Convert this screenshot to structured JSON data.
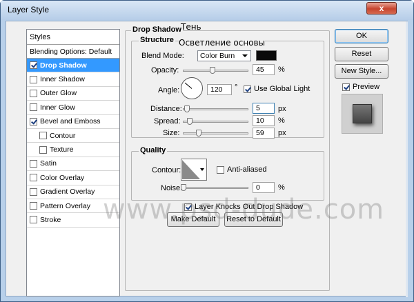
{
  "window": {
    "title": "Layer Style",
    "close_glyph": "x"
  },
  "sidebar": {
    "header": "Styles",
    "blending_options": "Blending Options: Default",
    "items": [
      {
        "label": "Drop Shadow",
        "checked": true,
        "active": true,
        "sub": false
      },
      {
        "label": "Inner Shadow",
        "checked": false,
        "active": false,
        "sub": false
      },
      {
        "label": "Outer Glow",
        "checked": false,
        "active": false,
        "sub": false
      },
      {
        "label": "Inner Glow",
        "checked": false,
        "active": false,
        "sub": false
      },
      {
        "label": "Bevel and Emboss",
        "checked": true,
        "active": false,
        "sub": false
      },
      {
        "label": "Contour",
        "checked": false,
        "active": false,
        "sub": true
      },
      {
        "label": "Texture",
        "checked": false,
        "active": false,
        "sub": true
      },
      {
        "label": "Satin",
        "checked": false,
        "active": false,
        "sub": false
      },
      {
        "label": "Color Overlay",
        "checked": false,
        "active": false,
        "sub": false
      },
      {
        "label": "Gradient Overlay",
        "checked": false,
        "active": false,
        "sub": false
      },
      {
        "label": "Pattern Overlay",
        "checked": false,
        "active": false,
        "sub": false
      },
      {
        "label": "Stroke",
        "checked": false,
        "active": false,
        "sub": false
      }
    ]
  },
  "drop_shadow": {
    "section_title": "Drop Shadow",
    "structure": {
      "title": "Structure",
      "blend_mode_label": "Blend Mode:",
      "blend_mode_value": "Color Burn",
      "shadow_color": "#0a0a0a",
      "opacity_label": "Opacity:",
      "opacity_value": "45",
      "opacity_unit": "%",
      "angle_label": "Angle:",
      "angle_value": "120",
      "angle_unit": "°",
      "use_global_light_label": "Use Global Light",
      "use_global_light_checked": true,
      "distance_label": "Distance:",
      "distance_value": "5",
      "distance_unit": "px",
      "spread_label": "Spread:",
      "spread_value": "10",
      "spread_unit": "%",
      "size_label": "Size:",
      "size_value": "59",
      "size_unit": "px"
    },
    "quality": {
      "title": "Quality",
      "contour_label": "Contour:",
      "anti_aliased_label": "Anti-aliased",
      "anti_aliased_checked": false,
      "noise_label": "Noise:",
      "noise_value": "0",
      "noise_unit": "%"
    },
    "knocks_out_label": "Layer Knocks Out Drop Shadow",
    "knocks_out_checked": true,
    "make_default_label": "Make Default",
    "reset_default_label": "Reset to Default"
  },
  "buttons": {
    "ok": "OK",
    "reset": "Reset",
    "new_style": "New Style...",
    "preview_label": "Preview",
    "preview_checked": true
  },
  "overlays": {
    "caption_shadow": "Тень",
    "caption_blend": "Осветление основы",
    "watermark": "www.psd-dude.com"
  }
}
